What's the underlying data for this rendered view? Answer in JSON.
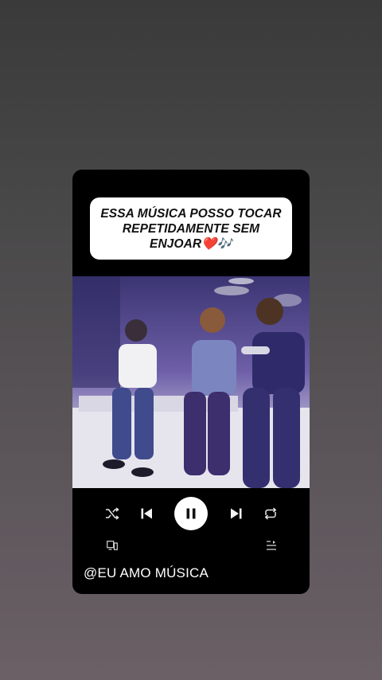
{
  "caption": {
    "text": "ESSA MÚSICA POSSO TOCAR REPETIDAMENTE SEM ENJOAR❤️🎶"
  },
  "player": {
    "state": "playing",
    "icons": {
      "shuffle": "shuffle-icon",
      "previous": "skip-previous-icon",
      "play_pause": "pause-icon",
      "next": "skip-next-icon",
      "repeat": "repeat-icon",
      "devices": "connect-device-icon",
      "queue": "queue-icon"
    }
  },
  "footer": {
    "handle": "@EU AMO MÚSICA"
  },
  "colors": {
    "card_bg": "#000000",
    "caption_bg": "#ffffff",
    "icon": "#e8e8e8"
  }
}
